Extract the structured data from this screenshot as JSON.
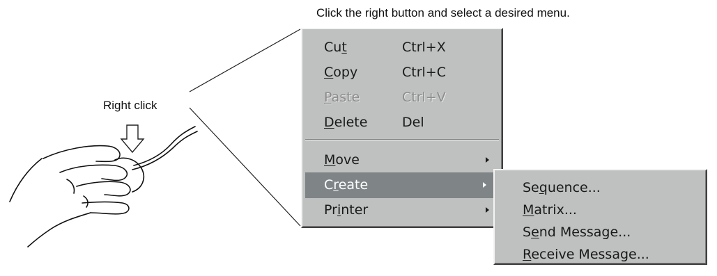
{
  "caption": "Click the right button and select a desired menu.",
  "right_click_label": "Right click",
  "context_menu": {
    "items": [
      {
        "pre": "Cu",
        "key": "t",
        "post": "",
        "accel": "Ctrl+X",
        "enabled": true
      },
      {
        "pre": "",
        "key": "C",
        "post": "opy",
        "accel": "Ctrl+C",
        "enabled": true
      },
      {
        "pre": "",
        "key": "P",
        "post": "aste",
        "accel": "Ctrl+V",
        "enabled": false
      },
      {
        "pre": "",
        "key": "D",
        "post": "elete",
        "accel": "Del",
        "enabled": true
      },
      {
        "pre": "",
        "key": "M",
        "post": "ove",
        "accel": "",
        "enabled": true,
        "submenu": true
      },
      {
        "pre": "C",
        "key": "r",
        "post": "eate",
        "accel": "",
        "enabled": true,
        "submenu": true,
        "highlighted": true
      },
      {
        "pre": "Pr",
        "key": "i",
        "post": "nter",
        "accel": "",
        "enabled": true,
        "submenu": true
      }
    ]
  },
  "create_submenu": {
    "items": [
      {
        "pre": "Se",
        "key": "q",
        "post": "uence..."
      },
      {
        "pre": "",
        "key": "M",
        "post": "atrix..."
      },
      {
        "pre": "S",
        "key": "e",
        "post": "nd Message..."
      },
      {
        "pre": "",
        "key": "R",
        "post": "eceive Message..."
      }
    ]
  },
  "colors": {
    "menu_bg": "#bfc0c0",
    "highlight_bg": "#7f8487",
    "disabled_text": "#8c8c8c"
  },
  "icons": [
    "down-arrow-icon",
    "hand-mouse-illustration",
    "submenu-arrow-icon"
  ]
}
